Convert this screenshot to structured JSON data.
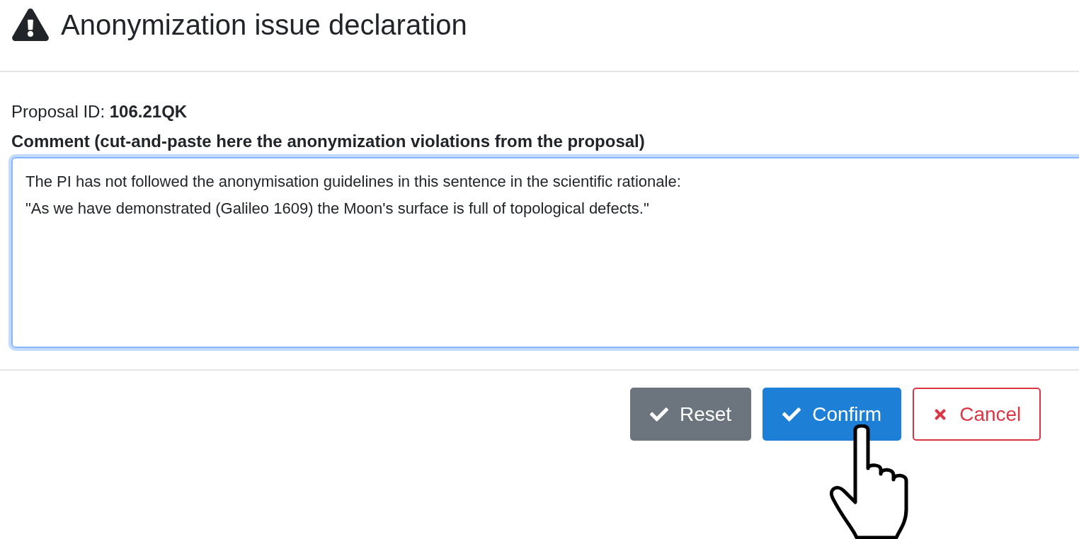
{
  "dialog": {
    "title": "Anonymization issue declaration",
    "proposal": "Proposal ID: **106.21QK**",
    "comment_label": "Comment (cut-and-paste here the anonymization violations from the proposal)",
    "comment_value": "The PI has not followed the anonymisation guidelines in this sentence in the scientific rationale:\n\"As we have demonstrated (Galileo 1609) the Moon's surface is full of topological defects.\"",
    "comment_focused": true,
    "buttons": [
      {
        "label": "Reset",
        "kind": "secondary"
      },
      {
        "label": "Confirm",
        "kind": "primary"
      },
      {
        "label": "Cancel",
        "kind": "cancel"
      }
    ]
  }
}
